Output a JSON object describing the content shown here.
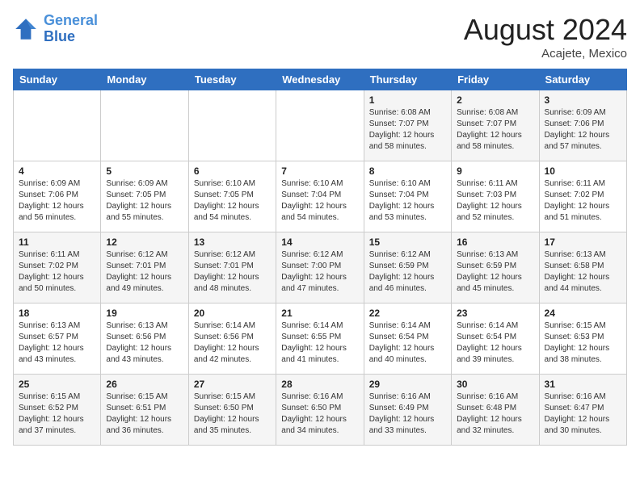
{
  "header": {
    "logo_line1": "General",
    "logo_line2": "Blue",
    "month_year": "August 2024",
    "location": "Acajete, Mexico"
  },
  "weekdays": [
    "Sunday",
    "Monday",
    "Tuesday",
    "Wednesday",
    "Thursday",
    "Friday",
    "Saturday"
  ],
  "weeks": [
    [
      {
        "day": "",
        "info": ""
      },
      {
        "day": "",
        "info": ""
      },
      {
        "day": "",
        "info": ""
      },
      {
        "day": "",
        "info": ""
      },
      {
        "day": "1",
        "info": "Sunrise: 6:08 AM\nSunset: 7:07 PM\nDaylight: 12 hours\nand 58 minutes."
      },
      {
        "day": "2",
        "info": "Sunrise: 6:08 AM\nSunset: 7:07 PM\nDaylight: 12 hours\nand 58 minutes."
      },
      {
        "day": "3",
        "info": "Sunrise: 6:09 AM\nSunset: 7:06 PM\nDaylight: 12 hours\nand 57 minutes."
      }
    ],
    [
      {
        "day": "4",
        "info": "Sunrise: 6:09 AM\nSunset: 7:06 PM\nDaylight: 12 hours\nand 56 minutes."
      },
      {
        "day": "5",
        "info": "Sunrise: 6:09 AM\nSunset: 7:05 PM\nDaylight: 12 hours\nand 55 minutes."
      },
      {
        "day": "6",
        "info": "Sunrise: 6:10 AM\nSunset: 7:05 PM\nDaylight: 12 hours\nand 54 minutes."
      },
      {
        "day": "7",
        "info": "Sunrise: 6:10 AM\nSunset: 7:04 PM\nDaylight: 12 hours\nand 54 minutes."
      },
      {
        "day": "8",
        "info": "Sunrise: 6:10 AM\nSunset: 7:04 PM\nDaylight: 12 hours\nand 53 minutes."
      },
      {
        "day": "9",
        "info": "Sunrise: 6:11 AM\nSunset: 7:03 PM\nDaylight: 12 hours\nand 52 minutes."
      },
      {
        "day": "10",
        "info": "Sunrise: 6:11 AM\nSunset: 7:02 PM\nDaylight: 12 hours\nand 51 minutes."
      }
    ],
    [
      {
        "day": "11",
        "info": "Sunrise: 6:11 AM\nSunset: 7:02 PM\nDaylight: 12 hours\nand 50 minutes."
      },
      {
        "day": "12",
        "info": "Sunrise: 6:12 AM\nSunset: 7:01 PM\nDaylight: 12 hours\nand 49 minutes."
      },
      {
        "day": "13",
        "info": "Sunrise: 6:12 AM\nSunset: 7:01 PM\nDaylight: 12 hours\nand 48 minutes."
      },
      {
        "day": "14",
        "info": "Sunrise: 6:12 AM\nSunset: 7:00 PM\nDaylight: 12 hours\nand 47 minutes."
      },
      {
        "day": "15",
        "info": "Sunrise: 6:12 AM\nSunset: 6:59 PM\nDaylight: 12 hours\nand 46 minutes."
      },
      {
        "day": "16",
        "info": "Sunrise: 6:13 AM\nSunset: 6:59 PM\nDaylight: 12 hours\nand 45 minutes."
      },
      {
        "day": "17",
        "info": "Sunrise: 6:13 AM\nSunset: 6:58 PM\nDaylight: 12 hours\nand 44 minutes."
      }
    ],
    [
      {
        "day": "18",
        "info": "Sunrise: 6:13 AM\nSunset: 6:57 PM\nDaylight: 12 hours\nand 43 minutes."
      },
      {
        "day": "19",
        "info": "Sunrise: 6:13 AM\nSunset: 6:56 PM\nDaylight: 12 hours\nand 43 minutes."
      },
      {
        "day": "20",
        "info": "Sunrise: 6:14 AM\nSunset: 6:56 PM\nDaylight: 12 hours\nand 42 minutes."
      },
      {
        "day": "21",
        "info": "Sunrise: 6:14 AM\nSunset: 6:55 PM\nDaylight: 12 hours\nand 41 minutes."
      },
      {
        "day": "22",
        "info": "Sunrise: 6:14 AM\nSunset: 6:54 PM\nDaylight: 12 hours\nand 40 minutes."
      },
      {
        "day": "23",
        "info": "Sunrise: 6:14 AM\nSunset: 6:54 PM\nDaylight: 12 hours\nand 39 minutes."
      },
      {
        "day": "24",
        "info": "Sunrise: 6:15 AM\nSunset: 6:53 PM\nDaylight: 12 hours\nand 38 minutes."
      }
    ],
    [
      {
        "day": "25",
        "info": "Sunrise: 6:15 AM\nSunset: 6:52 PM\nDaylight: 12 hours\nand 37 minutes."
      },
      {
        "day": "26",
        "info": "Sunrise: 6:15 AM\nSunset: 6:51 PM\nDaylight: 12 hours\nand 36 minutes."
      },
      {
        "day": "27",
        "info": "Sunrise: 6:15 AM\nSunset: 6:50 PM\nDaylight: 12 hours\nand 35 minutes."
      },
      {
        "day": "28",
        "info": "Sunrise: 6:16 AM\nSunset: 6:50 PM\nDaylight: 12 hours\nand 34 minutes."
      },
      {
        "day": "29",
        "info": "Sunrise: 6:16 AM\nSunset: 6:49 PM\nDaylight: 12 hours\nand 33 minutes."
      },
      {
        "day": "30",
        "info": "Sunrise: 6:16 AM\nSunset: 6:48 PM\nDaylight: 12 hours\nand 32 minutes."
      },
      {
        "day": "31",
        "info": "Sunrise: 6:16 AM\nSunset: 6:47 PM\nDaylight: 12 hours\nand 30 minutes."
      }
    ]
  ]
}
